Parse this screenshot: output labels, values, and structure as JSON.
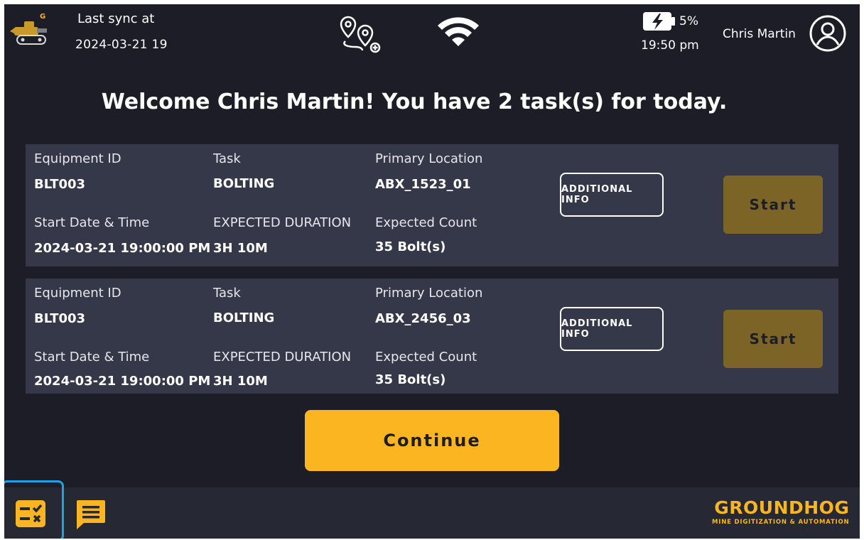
{
  "header": {
    "sync_label": "Last sync at",
    "sync_value": "2024-03-21 19",
    "logo_letter": "G",
    "battery_pct": "5%",
    "time": "19:50 pm",
    "user_name": "Chris Martin",
    "icons": [
      "route-icon",
      "wifi-icon",
      "battery-charging-icon",
      "user-avatar-icon",
      "machine-logo-icon"
    ]
  },
  "welcome": "Welcome Chris Martin! You have 2 task(s) for today.",
  "labels": {
    "equipment_id": "Equipment ID",
    "task": "Task",
    "primary_location": "Primary Location",
    "start_datetime": "Start Date & Time",
    "expected_duration": "EXPECTED DURATION",
    "expected_count": "Expected Count",
    "additional_info": "ADDITIONAL INFO",
    "start": "Start"
  },
  "tasks": [
    {
      "equipment_id": "BLT003",
      "task": "BOLTING",
      "primary_location": "ABX_1523_01",
      "start_datetime": "2024-03-21 19:00:00 PM",
      "expected_duration": "3H 10M",
      "expected_count": "35 Bolt(s)"
    },
    {
      "equipment_id": "BLT003",
      "task": "BOLTING",
      "primary_location": "ABX_2456_03",
      "start_datetime": "2024-03-21 19:00:00 PM",
      "expected_duration": "3H 10M",
      "expected_count": "35 Bolt(s)"
    }
  ],
  "continue_label": "Continue",
  "footer": {
    "brand_name": "GROUNDHOG",
    "brand_tagline": "MINE DIGITIZATION & AUTOMATION",
    "nav_icons": [
      "tasks-icon",
      "chat-icon"
    ]
  },
  "colors": {
    "background": "#1c1d26",
    "card": "#353848",
    "accent": "#fbb520",
    "start_button": "#7c6426",
    "selection_outline": "#1fa3e0"
  }
}
